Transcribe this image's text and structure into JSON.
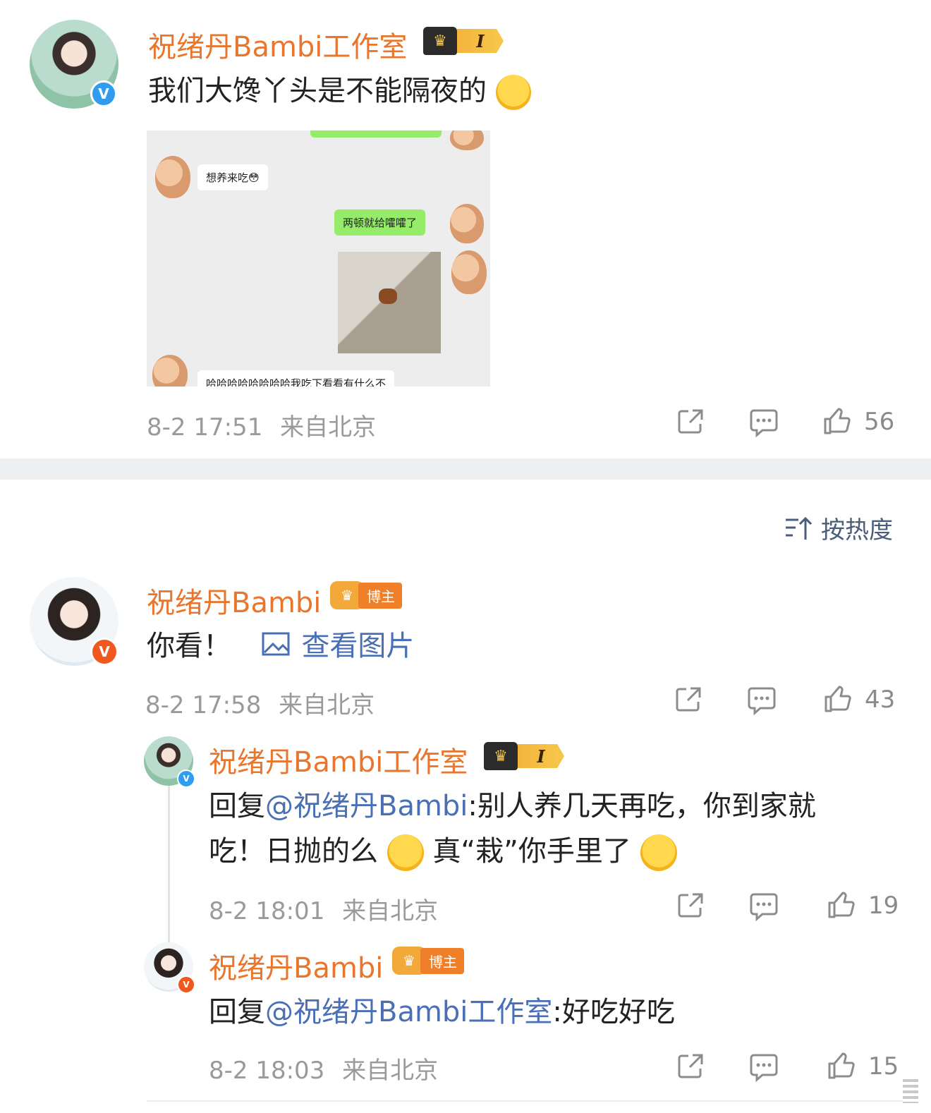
{
  "comment1": {
    "username": "祝绪丹Bambi工作室",
    "level": "I",
    "text": "我们大馋丫头是不能隔夜的",
    "emoji": "sweat-smile",
    "chat_image": {
      "bubble1": "想养来吃😳",
      "bubble2": "两顿就给嚯嚯了",
      "bubble3": "哈哈哈哈哈哈哈哈我吃下看看有什么不"
    },
    "time": "8-2 17:51",
    "location": "来自北京",
    "likes": "56"
  },
  "sort": {
    "label": "按热度"
  },
  "comment2": {
    "username": "祝绪丹Bambi",
    "badge_label": "博主",
    "text": "你看！",
    "link_text": "查看图片",
    "time": "8-2 17:58",
    "location": "来自北京",
    "likes": "43"
  },
  "reply1": {
    "username": "祝绪丹Bambi工作室",
    "level": "I",
    "prefix": "回复",
    "mention": "@祝绪丹Bambi",
    "line1": ":别人养几天再吃，你到家就",
    "line2a": "吃！日抛的么",
    "line2b": "真“栽”你手里了",
    "time": "8-2 18:01",
    "location": "来自北京",
    "likes": "19"
  },
  "reply2": {
    "username": "祝绪丹Bambi",
    "badge_label": "博主",
    "prefix": "回复",
    "mention": "@祝绪丹Bambi工作室",
    "text": ":好吃好吃",
    "time": "8-2 18:03",
    "location": "来自北京",
    "likes": "15"
  },
  "colors": {
    "username": "#e8762e",
    "link": "#4a6fb5",
    "meta": "#9a9a9a",
    "divider": "#eeeff1"
  }
}
